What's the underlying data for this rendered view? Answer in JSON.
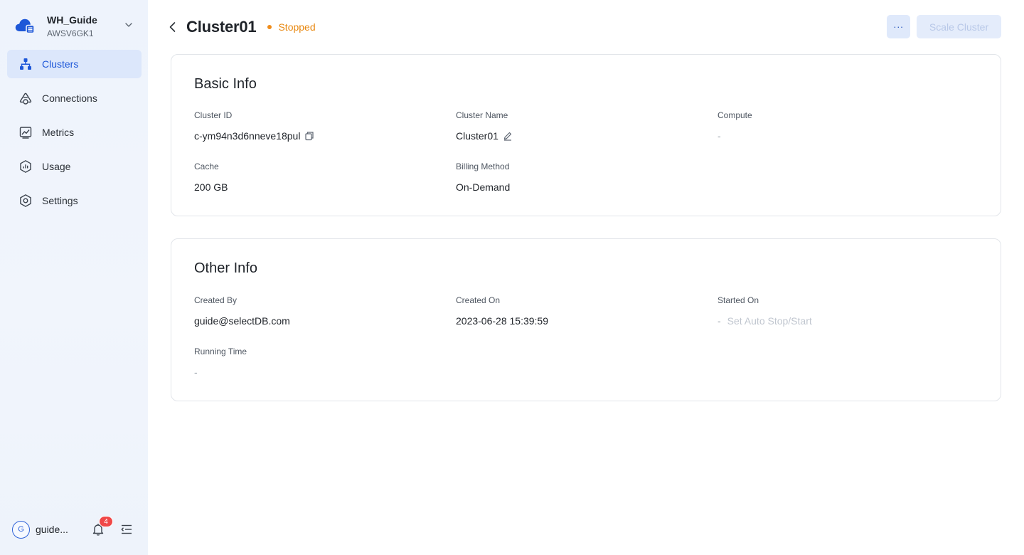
{
  "workspace": {
    "name": "WH_Guide",
    "id": "AWSV6GK1"
  },
  "nav": {
    "items": [
      {
        "label": "Clusters",
        "icon": "clusters-icon",
        "active": true
      },
      {
        "label": "Connections",
        "icon": "connections-icon",
        "active": false
      },
      {
        "label": "Metrics",
        "icon": "metrics-icon",
        "active": false
      },
      {
        "label": "Usage",
        "icon": "usage-icon",
        "active": false
      },
      {
        "label": "Settings",
        "icon": "gear-icon",
        "active": false
      }
    ]
  },
  "footer": {
    "avatar_letter": "G",
    "user_name": "guide...",
    "notification_count": "4"
  },
  "header": {
    "title": "Cluster01",
    "status": "Stopped",
    "more_label": "···",
    "scale_label": "Scale Cluster"
  },
  "basic_info": {
    "title": "Basic Info",
    "cluster_id_label": "Cluster ID",
    "cluster_id": "c-ym94n3d6nneve18pul",
    "cluster_name_label": "Cluster Name",
    "cluster_name": "Cluster01",
    "compute_label": "Compute",
    "compute": "-",
    "cache_label": "Cache",
    "cache": "200 GB",
    "billing_label": "Billing Method",
    "billing": "On-Demand"
  },
  "other_info": {
    "title": "Other Info",
    "created_by_label": "Created By",
    "created_by": "guide@selectDB.com",
    "created_on_label": "Created On",
    "created_on": "2023-06-28 15:39:59",
    "started_on_label": "Started On",
    "started_on": "-",
    "auto_stop_link": "Set Auto Stop/Start",
    "running_time_label": "Running Time",
    "running_time": "-"
  },
  "colors": {
    "accent": "#1d57d8",
    "status_stopped": "#e8870f",
    "badge": "#f04848"
  }
}
